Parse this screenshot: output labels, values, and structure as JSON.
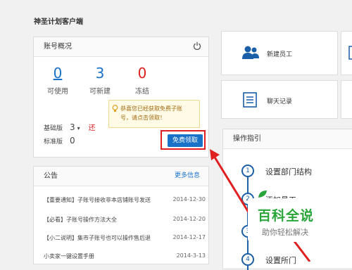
{
  "app": {
    "title": "神圣计划客户端"
  },
  "account": {
    "title": "账号概况",
    "stats": [
      {
        "value": "0",
        "label": "可使用",
        "color": "#1a72c8"
      },
      {
        "value": "3",
        "label": "可新建",
        "color": "#1a72c8"
      },
      {
        "value": "0",
        "label": "冻结",
        "color": "#e02020"
      }
    ],
    "basic": {
      "label": "基础版",
      "value": "3",
      "caret": "▾",
      "renew": "还"
    },
    "standard": {
      "label": "标准版",
      "value": "0"
    },
    "tooltip": {
      "line1": "恭喜您已经获取免费子账",
      "line2": "号，请点击领取！"
    },
    "free_button": "免费领取"
  },
  "notice": {
    "title": "公告",
    "more": "更多信息",
    "items": [
      {
        "text": "【重要通知】子账号接收非本店铺账号发送",
        "date": "2014-12-30"
      },
      {
        "text": "【必看】子账号操作方法大全",
        "date": "2014-12-20"
      },
      {
        "text": "【小二说明】集市子账号也可以操作售后退",
        "date": "2014-12-17"
      },
      {
        "text": "小卖家一键设置手册",
        "date": "2014-3-13"
      }
    ]
  },
  "tiles": {
    "new_employee": "新建员工",
    "chat_record": "聊天记录"
  },
  "guide": {
    "title": "操作指引",
    "steps": [
      {
        "num": "1",
        "text": "设置部门结构"
      },
      {
        "num": "2",
        "text": "添加员工"
      },
      {
        "num": "3",
        "text": ""
      },
      {
        "num": "4",
        "text": "设置所门"
      }
    ]
  },
  "watermark": {
    "title": "百科全说",
    "subtitle": "助你轻松解决"
  },
  "colors": {
    "accent": "#1a72c8",
    "danger": "#e02020",
    "brand_green": "#2aa53a"
  }
}
